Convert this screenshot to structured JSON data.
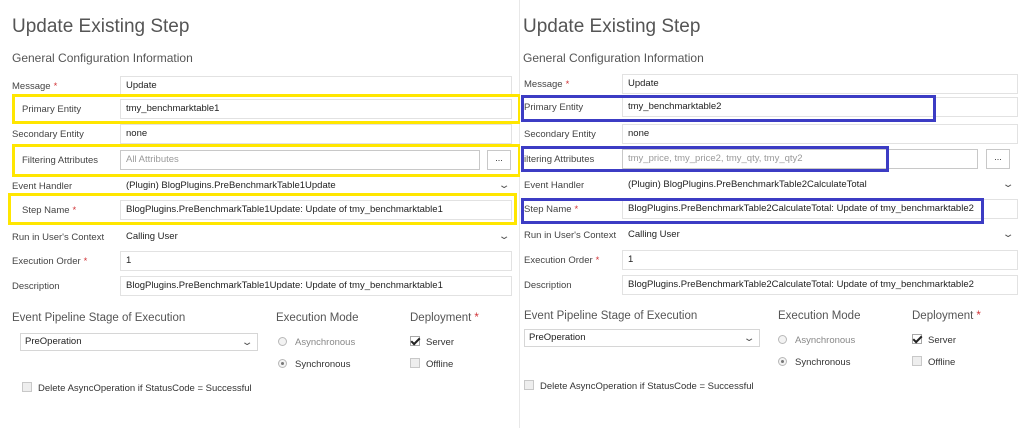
{
  "left": {
    "title": "Update Existing Step",
    "subtitle": "General Configuration Information",
    "labels": {
      "message": "Message",
      "primary_entity": "Primary Entity",
      "secondary_entity": "Secondary Entity",
      "filtering_attributes": "Filtering Attributes",
      "event_handler": "Event Handler",
      "step_name": "Step Name",
      "run_context": "Run in User's Context",
      "execution_order": "Execution Order",
      "description": "Description"
    },
    "values": {
      "message": "Update",
      "primary_entity": "tmy_benchmarktable1",
      "secondary_entity": "none",
      "filtering_placeholder": "All Attributes",
      "event_handler": "(Plugin) BlogPlugins.PreBenchmarkTable1Update",
      "step_name": "BlogPlugins.PreBenchmarkTable1Update: Update of tmy_benchmarktable1",
      "run_context": "Calling User",
      "execution_order": "1",
      "description": "BlogPlugins.PreBenchmarkTable1Update: Update of tmy_benchmarktable1"
    },
    "dots_label": "...",
    "pipeline": {
      "label": "Event Pipeline Stage of Execution",
      "value": "PreOperation"
    },
    "execution_mode": {
      "label": "Execution Mode",
      "asynchronous": "Asynchronous",
      "synchronous": "Synchronous"
    },
    "deployment": {
      "label": "Deployment",
      "server": "Server",
      "offline": "Offline"
    },
    "delete_async": "Delete AsyncOperation if StatusCode = Successful"
  },
  "right": {
    "title": "Update Existing Step",
    "subtitle": "General Configuration Information",
    "labels": {
      "message": "Message",
      "primary_entity": "Primary Entity",
      "secondary_entity": "Secondary Entity",
      "filtering_attributes": "iltering Attributes",
      "event_handler": "Event Handler",
      "step_name": "Step Name",
      "run_context": "Run in User's Context",
      "execution_order": "Execution Order",
      "description": "Description"
    },
    "values": {
      "message": "Update",
      "primary_entity": "tmy_benchmarktable2",
      "secondary_entity": "none",
      "filtering_attributes": "tmy_price, tmy_price2, tmy_qty, tmy_qty2",
      "event_handler": "(Plugin) BlogPlugins.PreBenchmarkTable2CalculateTotal",
      "step_name": "BlogPlugins.PreBenchmarkTable2CalculateTotal: Update of tmy_benchmarktable2",
      "run_context": "Calling User",
      "execution_order": "1",
      "description": "BlogPlugins.PreBenchmarkTable2CalculateTotal: Update of tmy_benchmarktable2"
    },
    "dots_label": "...",
    "pipeline": {
      "label": "Event Pipeline Stage of Execution",
      "value": "PreOperation"
    },
    "execution_mode": {
      "label": "Execution Mode",
      "asynchronous": "Asynchronous",
      "synchronous": "Synchronous"
    },
    "deployment": {
      "label": "Deployment",
      "server": "Server",
      "offline": "Offline"
    },
    "delete_async": "Delete AsyncOperation if StatusCode = Successful"
  },
  "required_marker": "*",
  "icons": {
    "dropdown": "chevron-down-icon",
    "checkbox": "checkmark-icon",
    "radio": "radio-icon"
  },
  "colors": {
    "highlight_left": "#ffe600",
    "highlight_right": "#3c3cc4",
    "required": "#d13438"
  }
}
